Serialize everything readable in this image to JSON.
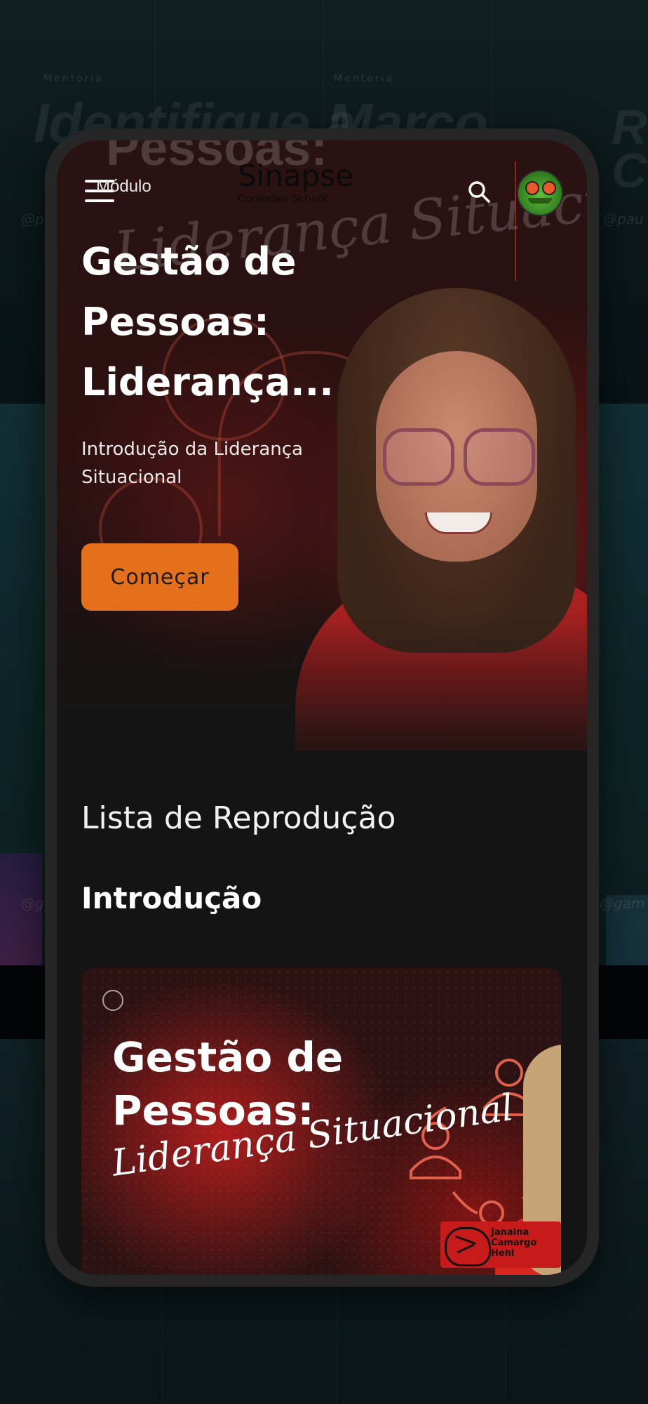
{
  "header": {
    "menu_label": "Módulo",
    "logo_main": "Sinapse",
    "logo_sub": "Conexões School"
  },
  "hero": {
    "title": "Gestão de Pessoas: Liderança...",
    "subtitle": "Introdução da Liderança Situacional",
    "start_button": "Começar"
  },
  "playlist": {
    "section_title": "Lista de Reprodução",
    "module_title": "Introdução",
    "card": {
      "title": "Gestão de Pessoas:",
      "script": "Liderança Situacional",
      "name_tag": "Janaina Camargo Hehl"
    }
  },
  "background": {
    "tile1_label": "Mentoria",
    "tile1_title": "Identifique a",
    "tile2_label": "Mentoria",
    "tile2_title": "Marco",
    "tile3_title": "Re Cr",
    "handle1": "@p",
    "handle2": "@pau",
    "handle3": "@g",
    "handle4": "@gam"
  },
  "colors": {
    "accent": "#e5701c",
    "screen_bg": "#141414",
    "card_red": "#c71a1a"
  },
  "icons": {
    "menu": "hamburger-menu-icon",
    "search": "search-icon",
    "avatar": "frog-avatar"
  }
}
